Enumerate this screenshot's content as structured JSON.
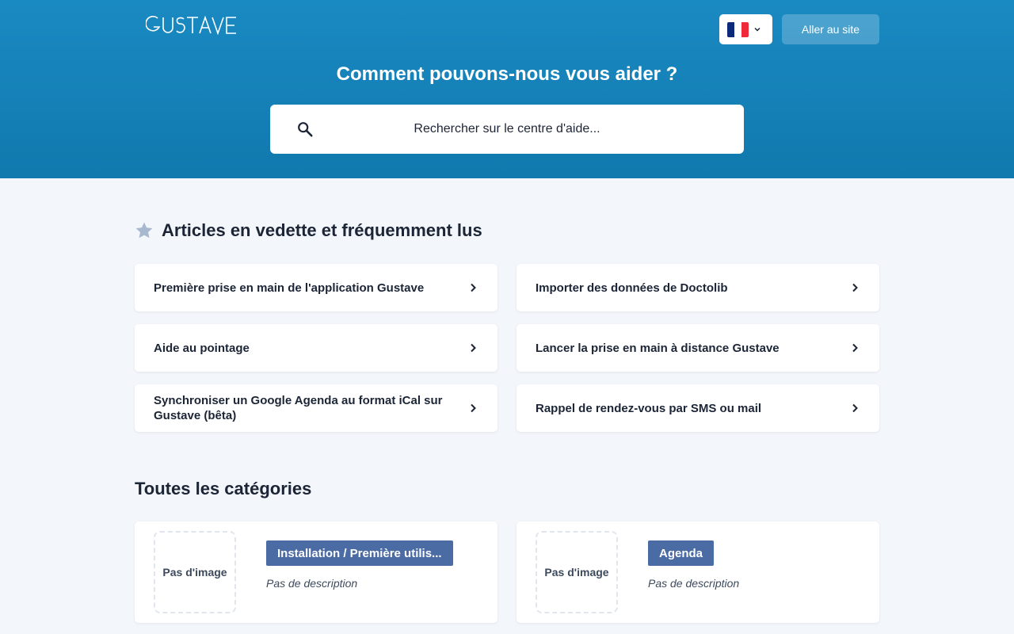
{
  "header": {
    "logo_text": "GUSTAVE",
    "language_flag": "fr-flag",
    "goto_site_label": "Aller au site",
    "title": "Comment pouvons-nous vous aider ?",
    "search_placeholder": "Rechercher sur le centre d'aide..."
  },
  "featured": {
    "title": "Articles en vedette et fréquemment lus",
    "articles": [
      "Première prise en main de l'application Gustave",
      "Importer des données de Doctolib",
      "Aide au pointage",
      "Lancer la prise en main à distance Gustave",
      "Synchroniser un Google Agenda au format iCal sur Gustave (bêta)",
      "Rappel de rendez-vous par SMS ou mail"
    ]
  },
  "categories": {
    "title": "Toutes les catégories",
    "items": [
      {
        "no_image": "Pas d'image",
        "name": "Installation / Première utilis...",
        "description": "Pas de description"
      },
      {
        "no_image": "Pas d'image",
        "name": "Agenda",
        "description": "Pas de description"
      }
    ]
  },
  "colors": {
    "hero": "#1a8ac2",
    "badge": "#4a6ba3",
    "background": "#f3f6fa"
  }
}
